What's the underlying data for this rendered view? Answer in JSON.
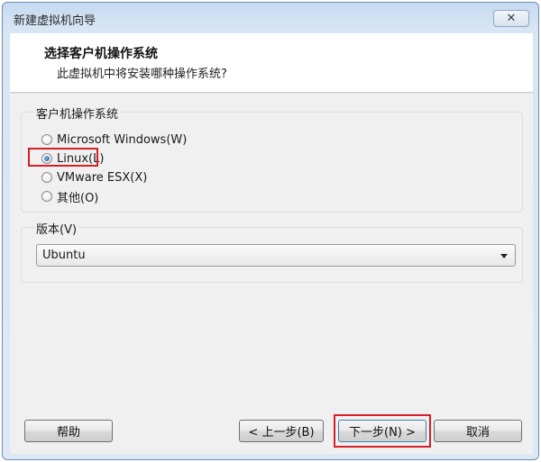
{
  "window": {
    "title": "新建虚拟机向导",
    "close_glyph": "✕"
  },
  "header": {
    "title": "选择客户机操作系统",
    "subtitle": "此虚拟机中将安装哪种操作系统?"
  },
  "os_group": {
    "label": "客户机操作系统",
    "options": [
      {
        "label": "Microsoft Windows(W)",
        "selected": false
      },
      {
        "label": "Linux(L)",
        "selected": true
      },
      {
        "label": "VMware ESX(X)",
        "selected": false
      },
      {
        "label": "其他(O)",
        "selected": false
      }
    ]
  },
  "version_group": {
    "label": "版本(V)",
    "selected_value": "Ubuntu"
  },
  "buttons": {
    "help": "帮助",
    "back": "< 上一步(B)",
    "next": "下一步(N) >",
    "cancel": "取消"
  },
  "colors": {
    "highlight": "#d61f26",
    "radio_selected": "#1f5fa8"
  }
}
